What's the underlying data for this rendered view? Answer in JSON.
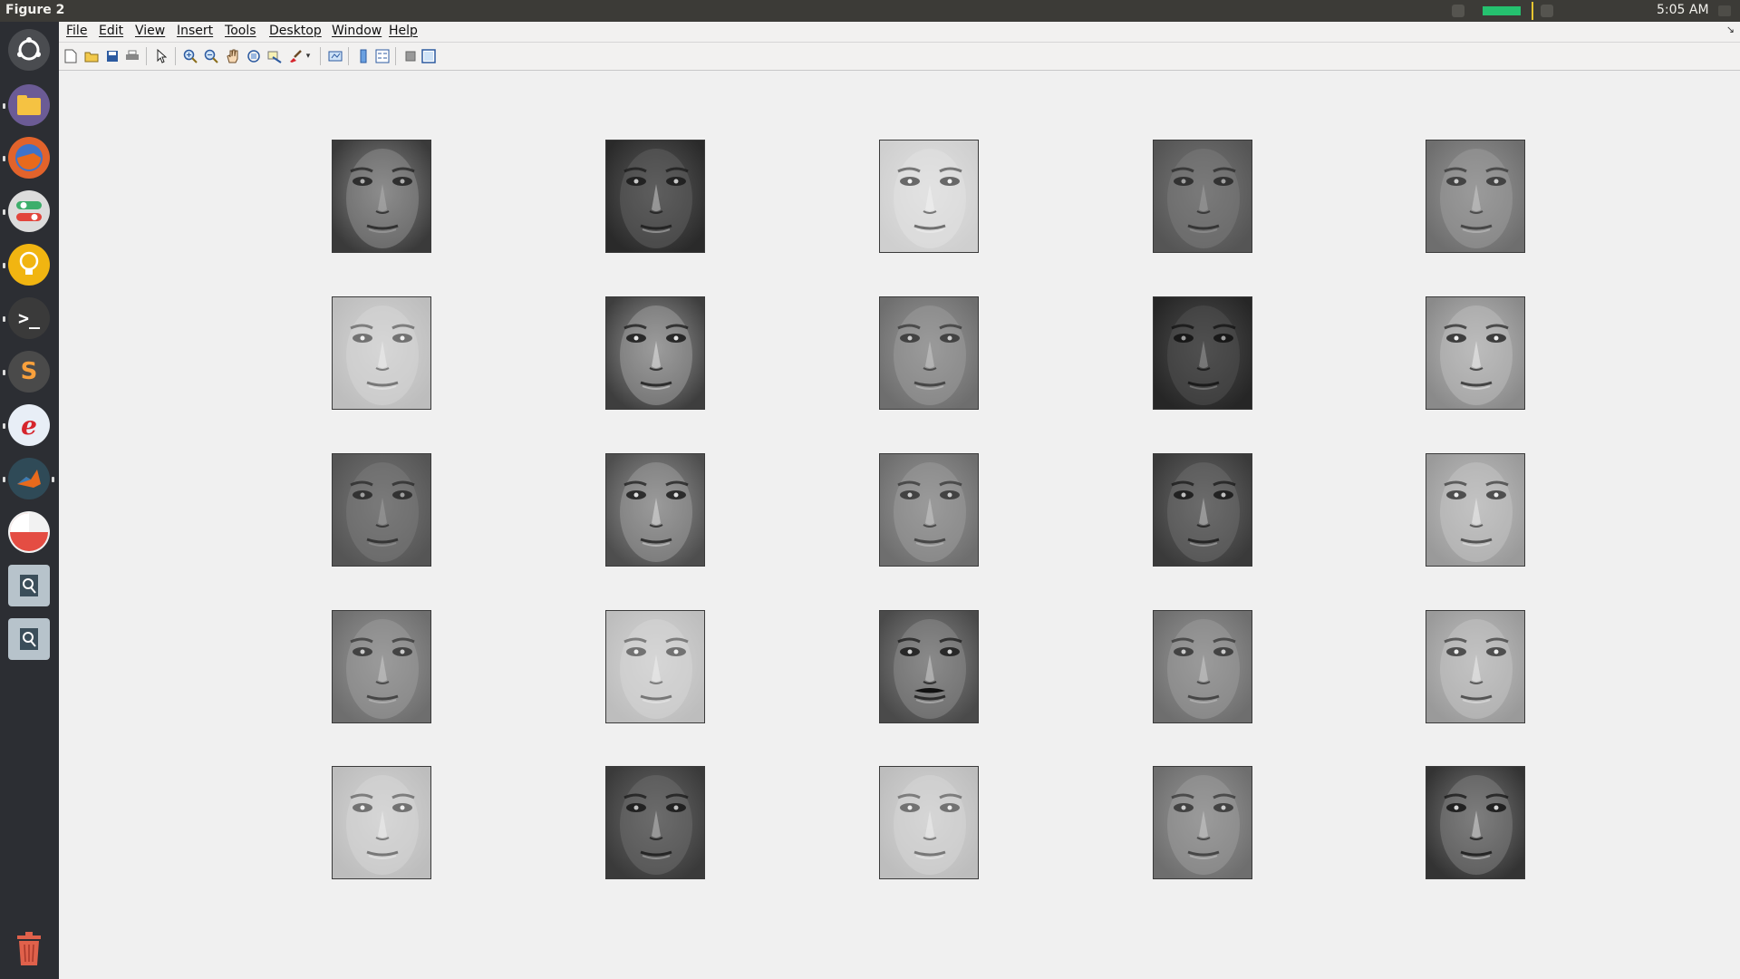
{
  "window": {
    "title": "Figure 2"
  },
  "topbar": {
    "clock": "5:05 AM"
  },
  "menus": [
    {
      "key": "F",
      "rest": "ile"
    },
    {
      "key": "E",
      "rest": "dit"
    },
    {
      "key": "V",
      "rest": "iew"
    },
    {
      "key": "I",
      "rest": "nsert"
    },
    {
      "key": "T",
      "rest": "ools"
    },
    {
      "key": "D",
      "rest": "esktop"
    },
    {
      "key": "W",
      "rest": "indow"
    },
    {
      "key": "H",
      "rest": "elp"
    }
  ],
  "toolbar": {
    "buttons": [
      "new-figure-icon",
      "open-file-icon",
      "save-icon",
      "print-icon",
      "edit-plot-icon",
      "zoom-in-icon",
      "zoom-out-icon",
      "pan-icon",
      "rotate-3d-icon",
      "data-cursor-icon",
      "brush-icon",
      "link-plot-icon",
      "insert-colorbar-icon",
      "insert-legend-icon",
      "hide-plot-tools-icon",
      "show-plot-tools-icon"
    ]
  },
  "launcher": {
    "apps": [
      "ubuntu-dash-icon",
      "files-icon",
      "firefox-icon",
      "settings-toggle-icon",
      "idea-bulb-icon",
      "terminal-icon",
      "sublime-text-icon",
      "text-editor-icon",
      "matlab-icon",
      "disk-usage-icon",
      "app-icon",
      "app-icon",
      "trash-icon"
    ]
  },
  "figure": {
    "grid": {
      "rows": 5,
      "cols": 5
    },
    "images": [
      {
        "tone": "dark-shade"
      },
      {
        "tone": "side-lit-dark"
      },
      {
        "tone": "light-shadow"
      },
      {
        "tone": "mid-dark"
      },
      {
        "tone": "mid-gray"
      },
      {
        "tone": "light"
      },
      {
        "tone": "high-contrast"
      },
      {
        "tone": "mid-gray"
      },
      {
        "tone": "very-dark"
      },
      {
        "tone": "contrast-light"
      },
      {
        "tone": "mid-dark"
      },
      {
        "tone": "contrast"
      },
      {
        "tone": "mid-gray"
      },
      {
        "tone": "dark"
      },
      {
        "tone": "light-gray"
      },
      {
        "tone": "mid-gray"
      },
      {
        "tone": "light"
      },
      {
        "tone": "dark-moustache"
      },
      {
        "tone": "mid-gray"
      },
      {
        "tone": "light-gray"
      },
      {
        "tone": "light"
      },
      {
        "tone": "dark"
      },
      {
        "tone": "light"
      },
      {
        "tone": "mid-gray"
      },
      {
        "tone": "dark-contrast"
      }
    ]
  },
  "colors": {
    "topbar": "#3c3b37",
    "launcher": "#2c2e33",
    "background": "#f0f0f0",
    "indicator_green": "#25c16f"
  }
}
